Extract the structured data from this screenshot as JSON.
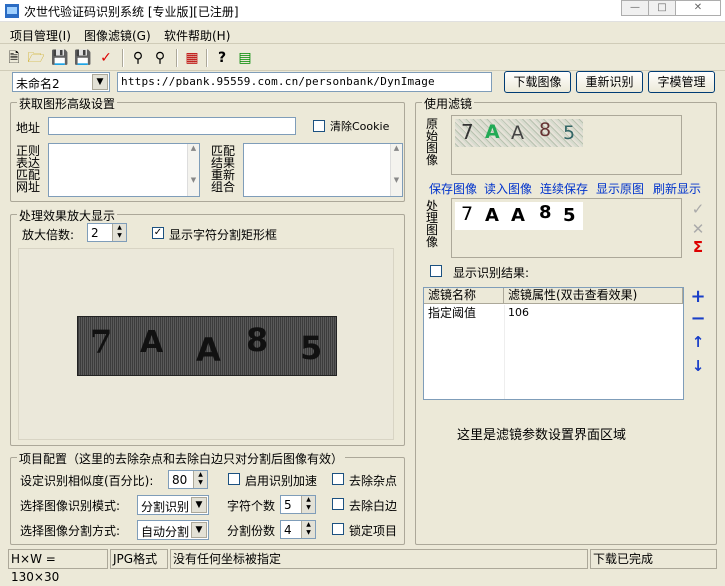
{
  "window": {
    "title": "次世代验证码识别系统 [专业版][已注册]"
  },
  "menu": [
    "项目管理(I)",
    "图像滤镜(G)",
    "软件帮助(H)"
  ],
  "top": {
    "project": "未命名2",
    "url": "https://pbank.95559.com.cn/personbank/DynImage",
    "download_label": "下载图像",
    "recognize_label": "重新识别",
    "font_label": "字模管理"
  },
  "fetch": {
    "group_label": "获取图形高级设置",
    "address_label": "地址",
    "clear_cookie_label": "清除Cookie",
    "regex_label": "正则表达匹配网址",
    "match_label": "匹配结果重新组合"
  },
  "zoom": {
    "group_label": "处理效果放大显示",
    "factor_label": "放大倍数:",
    "factor": "2",
    "show_rect_label": "显示字符分割矩形框",
    "captcha": [
      "7",
      "A",
      "A",
      "8",
      "5"
    ]
  },
  "config": {
    "group_label": "项目配置（这里的去除杂点和去除白边只对分割后图像有效）",
    "similarity_label": "设定识别相似度(百分比):",
    "similarity": "80",
    "accel_label": "启用识别加速",
    "noise_label": "去除杂点",
    "mode_label": "选择图像识别模式:",
    "mode": "分割识别",
    "charcount_label": "字符个数",
    "charcount": "5",
    "border_label": "去除白边",
    "split_label": "选择图像分割方式:",
    "split": "自动分割",
    "splitcount_label": "分割份数",
    "splitcount": "4",
    "lock_label": "锁定项目"
  },
  "filters": {
    "group_label": "使用滤镜",
    "orig_label": "原始图像",
    "proc_label": "处理图像",
    "links": [
      "保存图像",
      "读入图像",
      "连续保存",
      "显示原图",
      "刷新显示"
    ],
    "show_result_label": "显示识别结果:",
    "col1": "滤镜名称",
    "col2": "滤镜属性(双击查看效果)",
    "row_name": "指定阈值",
    "row_value": "106",
    "placeholder": "这里是滤镜参数设置界面区域",
    "orig_chars": [
      "7",
      "A",
      "A",
      "8",
      "5"
    ],
    "proc_chars": [
      "7",
      "A",
      "A",
      "8",
      "5"
    ]
  },
  "status": {
    "size": "H×W = 130×30",
    "format": "JPG格式",
    "coord": "没有任何坐标被指定",
    "state": "下载已完成"
  }
}
